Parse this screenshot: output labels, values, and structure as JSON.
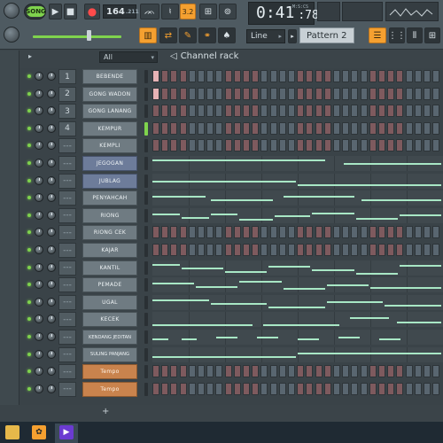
{
  "toolbar": {
    "song_mode_label": "SONG",
    "tempo_value": "164",
    "tempo_fraction": ".211",
    "time_minutes_seconds": "0:41",
    "time_centiseconds": ":78",
    "time_unit_label": "M:S:CS",
    "snap_label": "Line",
    "pattern_label": "Pattern 2",
    "snap_value_label": "3.2",
    "icons": [
      "fl-logo-icon",
      "play-icon",
      "stop-icon",
      "record-icon",
      "typing-keyboard-icon",
      "metronome-icon",
      "countdown-icon",
      "piano-roll-icon",
      "channel-rack-icon",
      "mixer-icon",
      "browser-icon",
      "playlist-icon"
    ]
  },
  "channel_rack": {
    "title": "Channel rack",
    "filter_label": "All",
    "add_button_label": "+",
    "channels": [
      {
        "mixer": "1",
        "name": "BEBENDE",
        "kind": "steps",
        "lit_steps": [
          0
        ],
        "style": "grey"
      },
      {
        "mixer": "2",
        "name": "GONG WADON",
        "kind": "steps",
        "lit_steps": [
          0
        ],
        "style": "grey"
      },
      {
        "mixer": "3",
        "name": "GONG LANANG",
        "kind": "steps",
        "lit_steps": [],
        "style": "grey"
      },
      {
        "mixer": "4",
        "name": "KEMPUR",
        "kind": "steps",
        "lit_steps": [],
        "style": "grey",
        "selected": true
      },
      {
        "mixer": "---",
        "name": "KEMPLI",
        "kind": "steps",
        "lit_steps": [],
        "style": "grey"
      },
      {
        "mixer": "---",
        "name": "JEGOGAN",
        "kind": "piano",
        "style": "blue"
      },
      {
        "mixer": "---",
        "name": "JUBLAG",
        "kind": "piano",
        "style": "blue"
      },
      {
        "mixer": "---",
        "name": "PENYAHCAH",
        "kind": "piano",
        "style": "grey"
      },
      {
        "mixer": "---",
        "name": "RIONG",
        "kind": "piano",
        "style": "grey"
      },
      {
        "mixer": "---",
        "name": "RIONG CEK",
        "kind": "steps",
        "lit_steps": [],
        "style": "grey"
      },
      {
        "mixer": "---",
        "name": "KAJAR",
        "kind": "steps",
        "lit_steps": [],
        "style": "grey"
      },
      {
        "mixer": "---",
        "name": "KANTIL",
        "kind": "piano",
        "style": "grey"
      },
      {
        "mixer": "---",
        "name": "PEMADE",
        "kind": "piano",
        "style": "grey"
      },
      {
        "mixer": "---",
        "name": "UGAL",
        "kind": "piano",
        "style": "grey"
      },
      {
        "mixer": "---",
        "name": "KECEK",
        "kind": "piano",
        "style": "grey"
      },
      {
        "mixer": "---",
        "name": "KENDANG JEDITAN",
        "kind": "piano",
        "style": "grey"
      },
      {
        "mixer": "---",
        "name": "SULING PANJANG",
        "kind": "piano",
        "style": "grey"
      },
      {
        "mixer": "---",
        "name": "Tempo",
        "kind": "steps",
        "lit_steps": [],
        "style": "tempo"
      },
      {
        "mixer": "---",
        "name": "Tempo",
        "kind": "steps",
        "lit_steps": [],
        "style": "tempo"
      }
    ]
  },
  "taskbar": {
    "icons": [
      "file-explorer-icon",
      "fl-studio-icon",
      "media-player-icon"
    ]
  },
  "colors": {
    "accent_orange": "#f5a030",
    "led_green": "#7fd34d",
    "note_green": "#a8e7c5",
    "step_grey": "#596670",
    "step_red": "#7e5a5e",
    "tempo_orange": "#c9834d"
  }
}
